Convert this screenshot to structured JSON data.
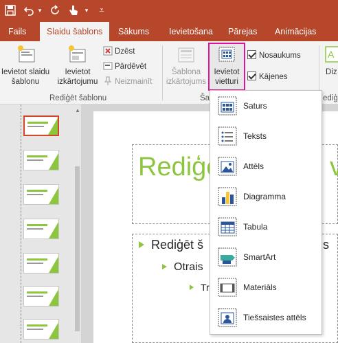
{
  "qat": {
    "icons": [
      "save-icon",
      "undo-icon",
      "undo-dropdown-icon",
      "repeat-icon",
      "touch-mode-icon",
      "qat-dropdown-icon",
      "customize-icon"
    ]
  },
  "tabs": [
    {
      "label": "Fails"
    },
    {
      "label": "Slaidu šablons",
      "active": true
    },
    {
      "label": "Sākums"
    },
    {
      "label": "Ievietošana"
    },
    {
      "label": "Pārejas"
    },
    {
      "label": "Animācijas"
    }
  ],
  "ribbon": {
    "insert_slide_master": "Ievietot slaidu šablonu",
    "insert_layout": "Ievietot izkārtojumu",
    "delete": "Dzēst",
    "rename": "Pārdēvēt",
    "preserve": "Neizmainīt",
    "group_edit_master": "Rediģēt šablonu",
    "master_layout": "Šablona izkārtojums",
    "insert_placeholder": "Ievietot vietturi",
    "title_check": "Nosaukums",
    "footers_check": "Kājenes",
    "group_master_layout_partial": "Šab",
    "group_edit_theme_partial": "ediģē",
    "right_partial_label": "Diz"
  },
  "slide": {
    "title": "Rediģēt",
    "title_tail": "v",
    "bullet1": "Rediģēt š",
    "bullet1_tail": "s",
    "bullet2": "Otrais",
    "bullet3": "Tr"
  },
  "placeholder_menu": {
    "items": [
      {
        "label": "Saturs",
        "icon": "content-placeholder-icon"
      },
      {
        "label": "Teksts",
        "icon": "text-placeholder-icon"
      },
      {
        "label": "Attēls",
        "icon": "picture-placeholder-icon"
      },
      {
        "label": "Diagramma",
        "icon": "chart-placeholder-icon"
      },
      {
        "label": "Tabula",
        "icon": "table-placeholder-icon"
      },
      {
        "label": "SmartArt",
        "icon": "smartart-placeholder-icon"
      },
      {
        "label": "Materiāls",
        "icon": "media-placeholder-icon"
      },
      {
        "label": "Tiešsaistes attēls",
        "icon": "online-picture-placeholder-icon"
      }
    ]
  },
  "colors": {
    "accent": "#b7472a",
    "theme_green": "#8cc63f",
    "highlight": "#e0149a"
  }
}
